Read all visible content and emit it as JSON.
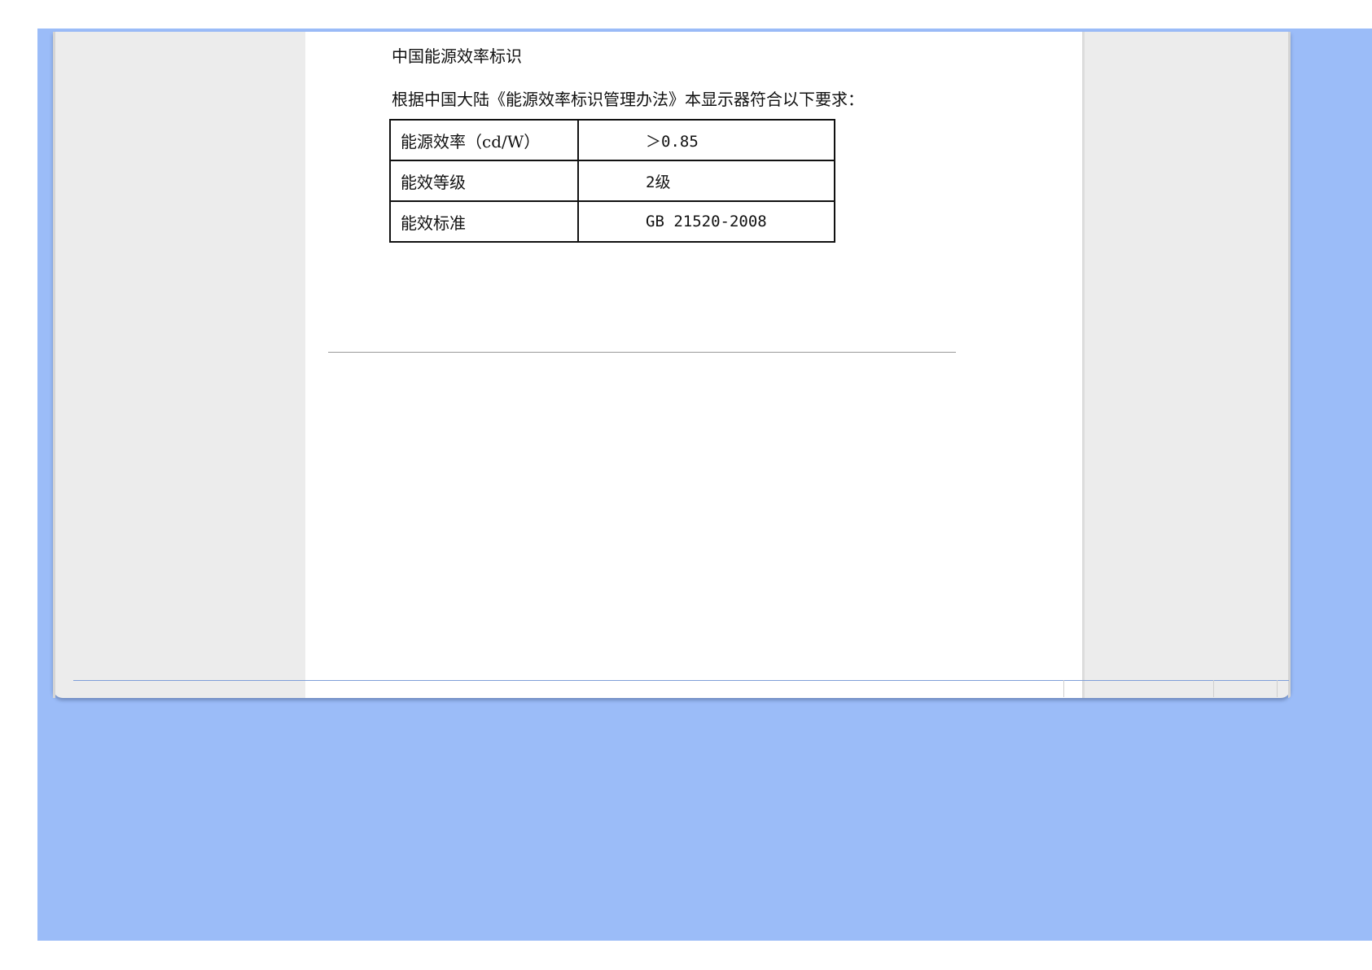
{
  "document": {
    "section_title": "中国能源效率标识",
    "intro_text": "根据中国大陆《能源效率标识管理办法》本显示器符合以下要求：",
    "table": {
      "rows": [
        {
          "label": "能源效率（cd/W）",
          "value": "＞0.85"
        },
        {
          "label": "能效等级",
          "value": "2级"
        },
        {
          "label": "能效标准",
          "value": "GB 21520-2008"
        }
      ]
    }
  },
  "colors": {
    "background_blue": "#9bbcf8",
    "side_panel_gray": "#ececec",
    "content_white": "#ffffff",
    "text": "#111111"
  }
}
